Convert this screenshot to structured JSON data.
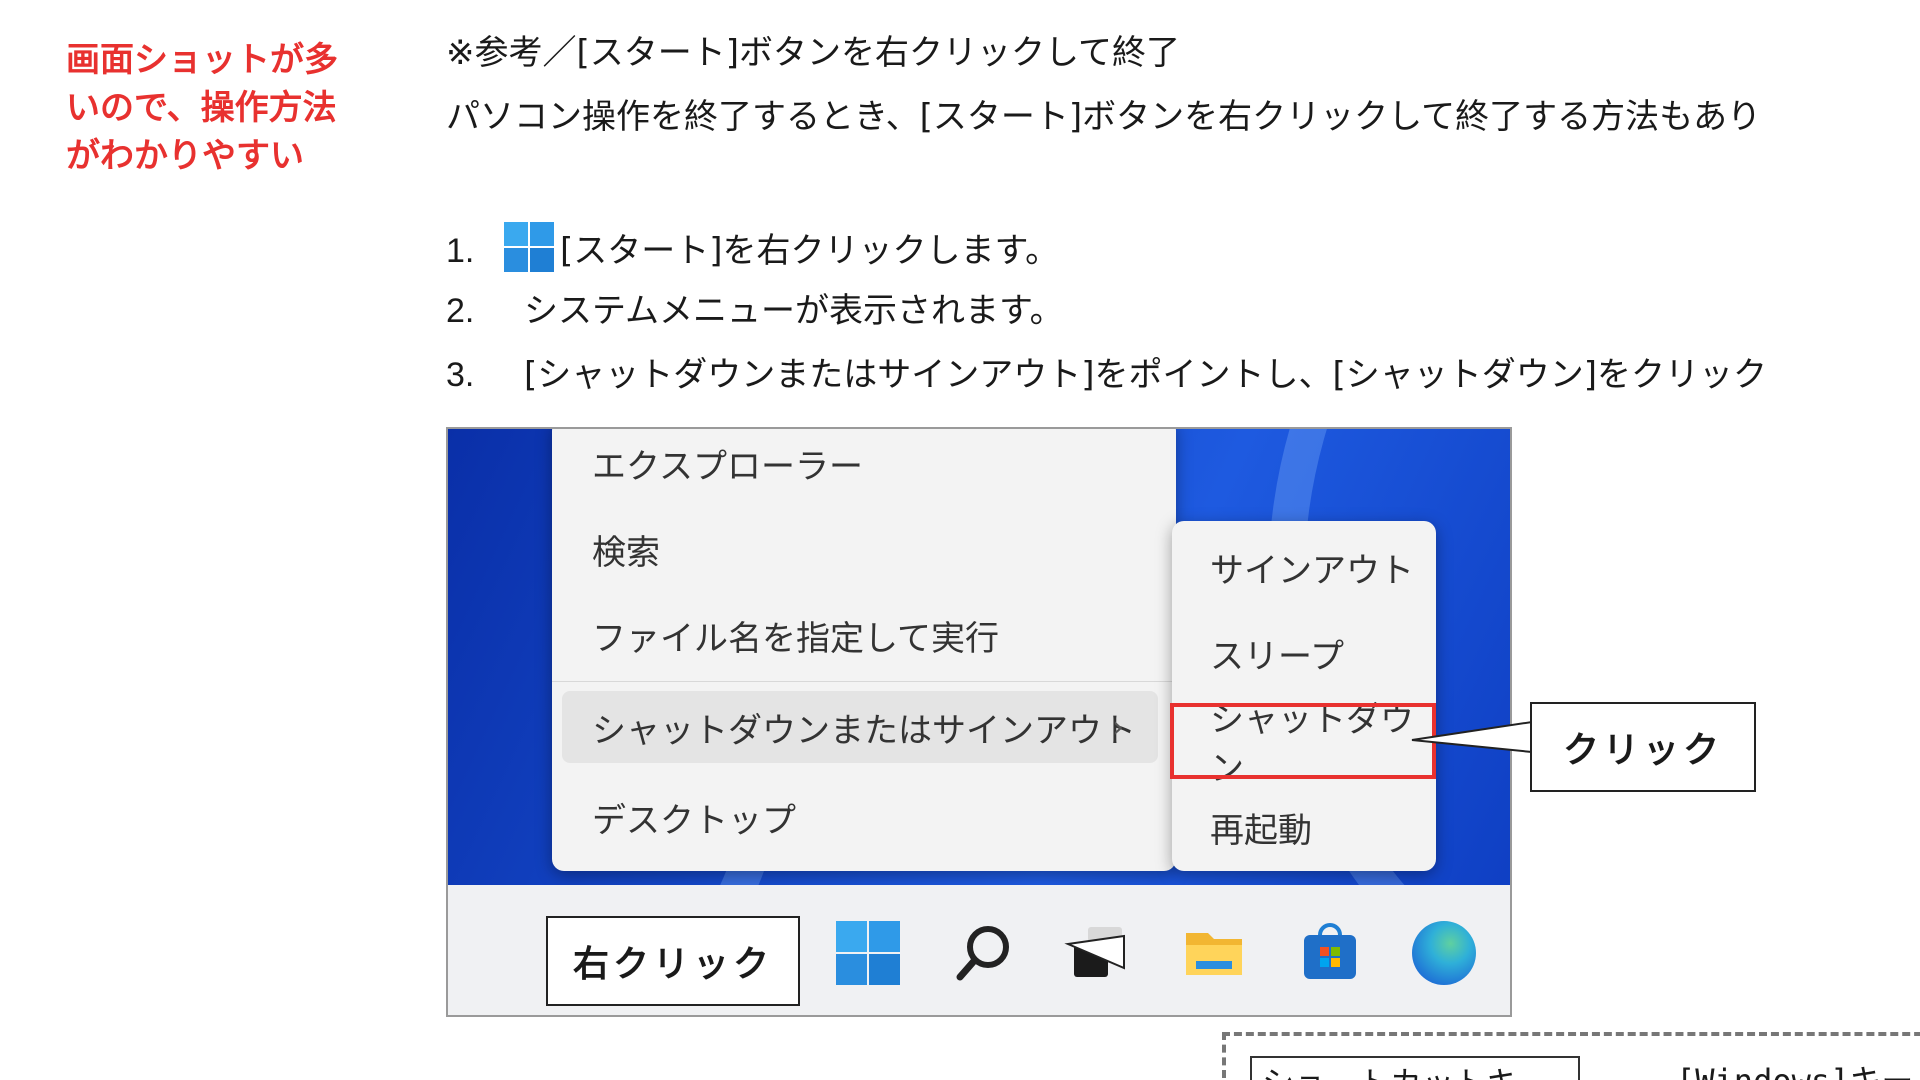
{
  "side_note": "画面ショットが多いので、操作方法がわかりやすい",
  "heading": "※参考／[スタート]ボタンを右クリックして終了",
  "intro": "パソコン操作を終了するとき、[スタート]ボタンを右クリックして終了する方法もあり",
  "steps": [
    {
      "num": "1.",
      "text": "[スタート]を右クリックします。"
    },
    {
      "num": "2.",
      "text": "システムメニューが表示されます。"
    },
    {
      "num": "3.",
      "text": "[シャットダウンまたはサインアウト]をポイントし、[シャットダウン]をクリック"
    }
  ],
  "context_menu": {
    "items": [
      "エクスプローラー",
      "検索",
      "ファイル名を指定して実行",
      "シャットダウンまたはサインアウト",
      "デスクトップ"
    ],
    "chevron": "›"
  },
  "sub_menu": {
    "items": [
      "サインアウト",
      "スリープ",
      "シャットダウン",
      "再起動"
    ]
  },
  "callouts": {
    "click": "クリック",
    "right_click": "右クリック"
  },
  "shortcut_box": {
    "label": "ショートカットキー",
    "text": "[Windows]キー"
  },
  "colors": {
    "note_red": "#e8312f",
    "highlight_red": "#e8312f",
    "wallpaper_blue": "#1448c9"
  }
}
